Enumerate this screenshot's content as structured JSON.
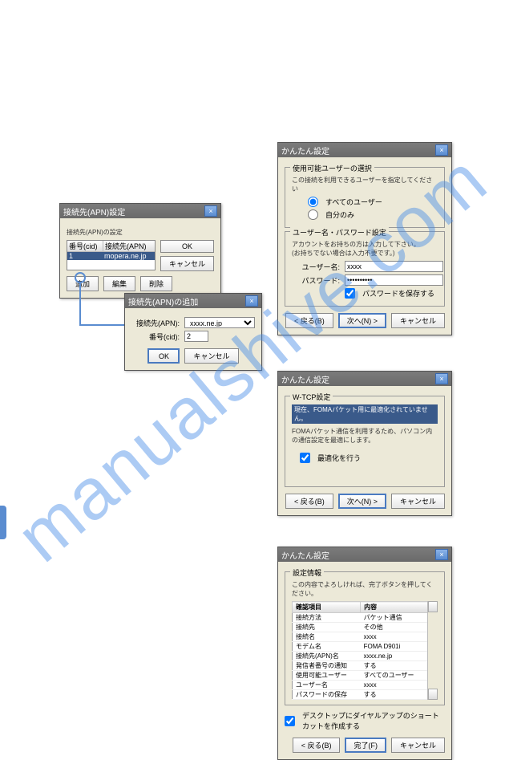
{
  "watermark": "manualshive.com",
  "d1": {
    "title": "接続先(APN)設定",
    "listLabel": "接続先(APN)の設定",
    "col1": "番号(cid)",
    "col2": "接続先(APN)",
    "row1": "1",
    "row1b": "mopera.ne.jp",
    "ok": "OK",
    "cancel": "キャンセル",
    "b1": "追加",
    "b2": "編集",
    "b3": "削除"
  },
  "d2": {
    "title": "接続先(APN)の追加",
    "l1": "接続先(APN):",
    "v1": "xxxx.ne.jp",
    "l2": "番号(cid):",
    "v2": "2",
    "ok": "OK",
    "cancel": "キャンセル"
  },
  "d3": {
    "title": "かんたん設定",
    "g1": "使用可能ユーザーの選択",
    "g1t": "この接続を利用できるユーザーを指定してください",
    "r1": "すべてのユーザー",
    "r2": "自分のみ",
    "g2": "ユーザー名・パスワード設定",
    "g2t": "アカウントをお持ちの方は入力して下さい。\\n(お持ちでない場合は入力不要です。)",
    "l1": "ユーザー名:",
    "v1": "xxxx",
    "l2": "パスワード:",
    "v2": "••••••••••",
    "cb": "パスワードを保存する",
    "back": "< 戻る(B)",
    "next": "次へ(N) >",
    "cancel": "キャンセル"
  },
  "d4": {
    "title": "かんたん設定",
    "g1": "W-TCP設定",
    "hl": "現在、FOMAパケット用に最適化されていません。",
    "txt": "FOMAパケット通信を利用するため、パソコン内の通信設定を最適にします。",
    "cb": "最適化を行う",
    "back": "< 戻る(B)",
    "next": "次へ(N) >",
    "cancel": "キャンセル"
  },
  "d5": {
    "title": "かんたん設定",
    "g1": "設定情報",
    "txt": "この内容でよろしければ、完了ボタンを押してください。",
    "h1": "確認項目",
    "h2": "内容",
    "rows": [
      [
        "接続方法",
        "パケット通信"
      ],
      [
        "接続先",
        "その他"
      ],
      [
        "接続名",
        "xxxx"
      ],
      [
        "モデム名",
        "FOMA D901i"
      ],
      [
        "接続先(APN)名",
        "xxxx.ne.jp"
      ],
      [
        "発信者番号の通知",
        "する"
      ],
      [
        "使用可能ユーザー",
        "すべてのユーザー"
      ],
      [
        "ユーザー名",
        "xxxx"
      ],
      [
        "パスワードの保存",
        "する"
      ]
    ],
    "cb": "デスクトップにダイヤルアップのショートカットを作成する",
    "back": "< 戻る(B)",
    "done": "完了(F)",
    "cancel": "キャンセル"
  }
}
